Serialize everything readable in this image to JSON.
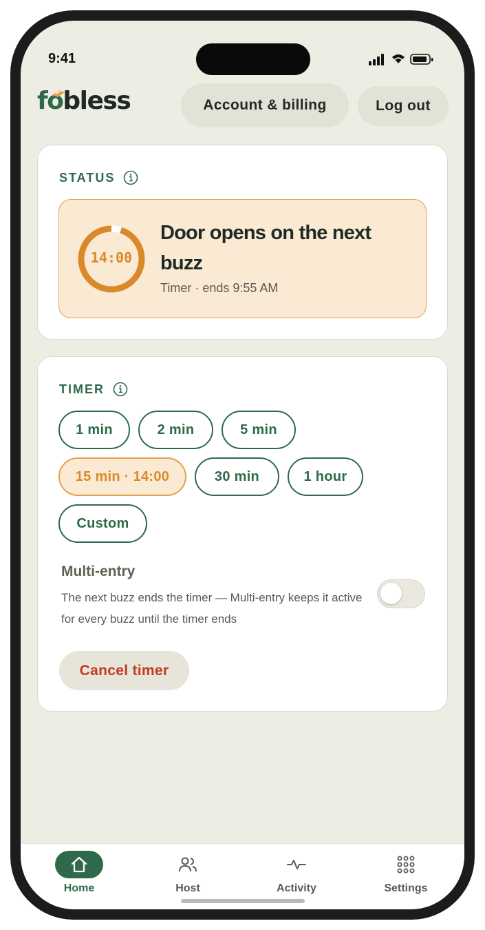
{
  "status_bar": {
    "time": "9:41"
  },
  "header": {
    "logo_prefix": "fo",
    "logo_suffix": "bless",
    "account_label": "Account & billing",
    "logout_label": "Log out"
  },
  "status_card": {
    "label": "STATUS",
    "countdown": "14:00",
    "countdown_progress": 0.95,
    "title": "Door opens on the next buzz",
    "subtitle": "Timer · ends 9:55 AM"
  },
  "timer_card": {
    "label": "TIMER",
    "options": [
      {
        "label": "1 min",
        "active": false
      },
      {
        "label": "2 min",
        "active": false
      },
      {
        "label": "5 min",
        "active": false
      },
      {
        "label": "15 min · 14:00",
        "active": true
      },
      {
        "label": "30 min",
        "active": false
      },
      {
        "label": "1 hour",
        "active": false
      },
      {
        "label": "Custom",
        "active": false
      }
    ],
    "multi_entry_title": "Multi-entry",
    "multi_entry_desc": "The next buzz ends the timer — Multi-entry keeps it active for every buzz until the timer ends",
    "multi_entry_enabled": false,
    "cancel_label": "Cancel timer"
  },
  "tabs": [
    {
      "label": "Home",
      "icon": "home-icon",
      "active": true
    },
    {
      "label": "Host",
      "icon": "users-icon",
      "active": false
    },
    {
      "label": "Activity",
      "icon": "activity-icon",
      "active": false
    },
    {
      "label": "Settings",
      "icon": "grid-icon",
      "active": false
    }
  ],
  "colors": {
    "brand_green": "#2e6a4a",
    "accent_orange": "#d9892a",
    "danger_red": "#c23b22",
    "background": "#edede4"
  }
}
